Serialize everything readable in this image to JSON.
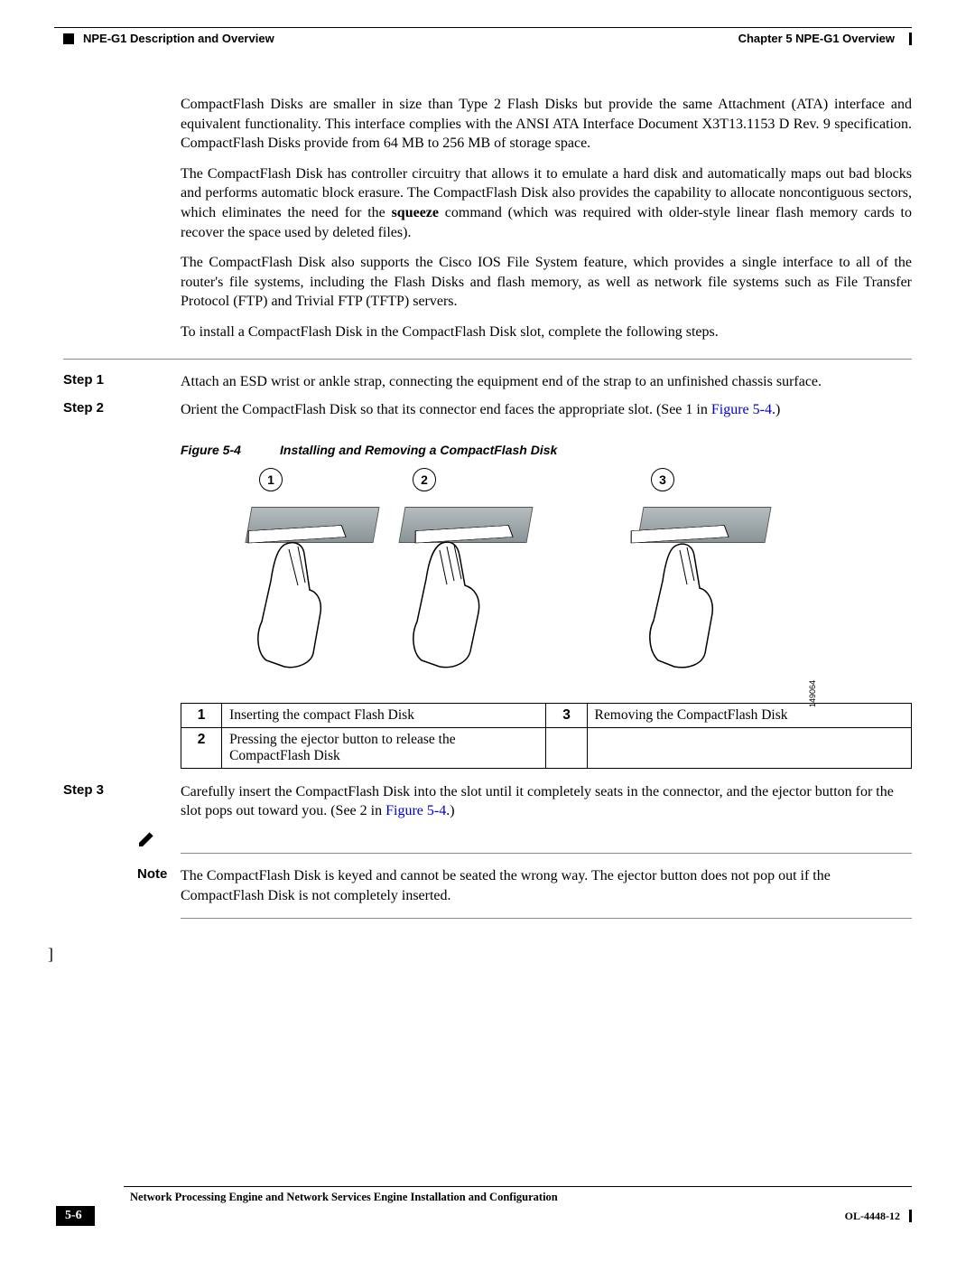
{
  "header": {
    "section_left": "NPE-G1 Description and Overview",
    "chapter_right": "Chapter 5    NPE-G1 Overview"
  },
  "paragraphs": {
    "p1a": "CompactFlash Disks are smaller in size than Type 2 Flash Disks but provide the same Attachment (ATA) interface and equivalent functionality. This interface complies with the ANSI ATA Interface Document X3T13.1153 D Rev. 9 specification. CompactFlash Disks provide from 64 MB to 256 MB of storage space.",
    "p2a": "The CompactFlash Disk has controller circuitry that allows it to emulate a hard disk and automatically maps out bad blocks and performs automatic block erasure. The CompactFlash Disk also provides the capability to allocate noncontiguous sectors, which eliminates the need for the ",
    "p2b": "squeeze",
    "p2c": " command (which was required with older-style linear flash memory cards to recover the space used by deleted files).",
    "p3": "The CompactFlash Disk also supports the Cisco IOS File System feature, which provides a single interface to all of the router's file systems, including the Flash Disks and flash memory, as well as network file systems such as File Transfer Protocol (FTP) and Trivial FTP (TFTP) servers.",
    "p4": "To install a CompactFlash Disk in the CompactFlash Disk slot, complete the following steps."
  },
  "steps": {
    "s1_label": "Step 1",
    "s1_text": "Attach an ESD wrist or ankle strap, connecting the equipment end of the strap to an unfinished chassis surface.",
    "s2_label": "Step 2",
    "s2_text_a": "Orient the CompactFlash Disk so that its connector end faces the appropriate slot. (See 1 in ",
    "s2_link": "Figure 5-4",
    "s2_text_b": ".)",
    "s3_label": "Step 3",
    "s3_text_a": "Carefully insert the CompactFlash Disk into the slot until it completely seats in the connector, and the ejector button for the slot pops out toward you. (See 2 in ",
    "s3_link": "Figure 5-4",
    "s3_text_b": ".)"
  },
  "figure": {
    "label": "Figure 5-4",
    "caption": "Installing and Removing a CompactFlash Disk",
    "panels": [
      "1",
      "2",
      "3"
    ],
    "id": "149064"
  },
  "legend": {
    "r1n": "1",
    "r1t": "Inserting the compact Flash Disk",
    "r2n": "2",
    "r2t": "Pressing the ejector button to release the CompactFlash Disk",
    "r3n": "3",
    "r3t": "Removing the CompactFlash Disk"
  },
  "note": {
    "label": "Note",
    "text": "The CompactFlash Disk is keyed and cannot be seated the wrong way. The ejector button does not pop out if the CompactFlash Disk is not completely inserted."
  },
  "footer": {
    "title": "Network Processing Engine and Network Services Engine Installation and Configuration",
    "page": "5-6",
    "doc": "OL-4448-12"
  },
  "bracket": "]"
}
